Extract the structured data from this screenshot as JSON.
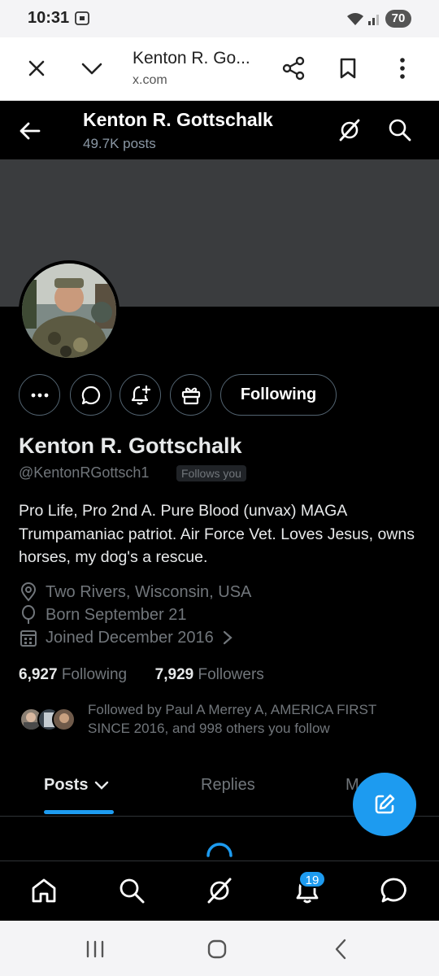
{
  "status_bar": {
    "time": "10:31",
    "battery": "70"
  },
  "browser": {
    "title": "Kenton R. Go...",
    "domain": "x.com"
  },
  "header": {
    "name": "Kenton R. Gottschalk",
    "posts_count": "49.7K posts"
  },
  "profile": {
    "following_button": "Following",
    "display_name": "Kenton R. Gottschalk",
    "handle": "@KentonRGottsch1",
    "follows_you": "Follows you",
    "bio": "Pro Life, Pro 2nd A.   Pure Blood (unvax) MAGA Trumpamaniac patriot.  Air Force Vet.  Loves Jesus, owns horses, my dog's a rescue.",
    "location": "Two Rivers, Wisconsin, USA",
    "birthday": "Born September 21",
    "joined": "Joined December 2016",
    "following_count": "6,927",
    "following_label": "Following",
    "followers_count": "7,929",
    "followers_label": "Followers",
    "followed_by": "Followed by Paul A Merrey A, AMERICA FIRST SINCE 2016, and 998 others you follow"
  },
  "tabs": [
    {
      "label": "Posts",
      "active": true
    },
    {
      "label": "Replies",
      "active": false
    },
    {
      "label": "M",
      "active": false
    }
  ],
  "bottom_nav": {
    "items": [
      "home-icon",
      "search-icon",
      "grok-icon",
      "notifications-icon",
      "messages-icon"
    ],
    "notification_badge": "19"
  },
  "colors": {
    "accent": "#1d9bf0",
    "background": "#000000",
    "secondary_text": "#71767b",
    "banner": "#3a3c3e"
  }
}
